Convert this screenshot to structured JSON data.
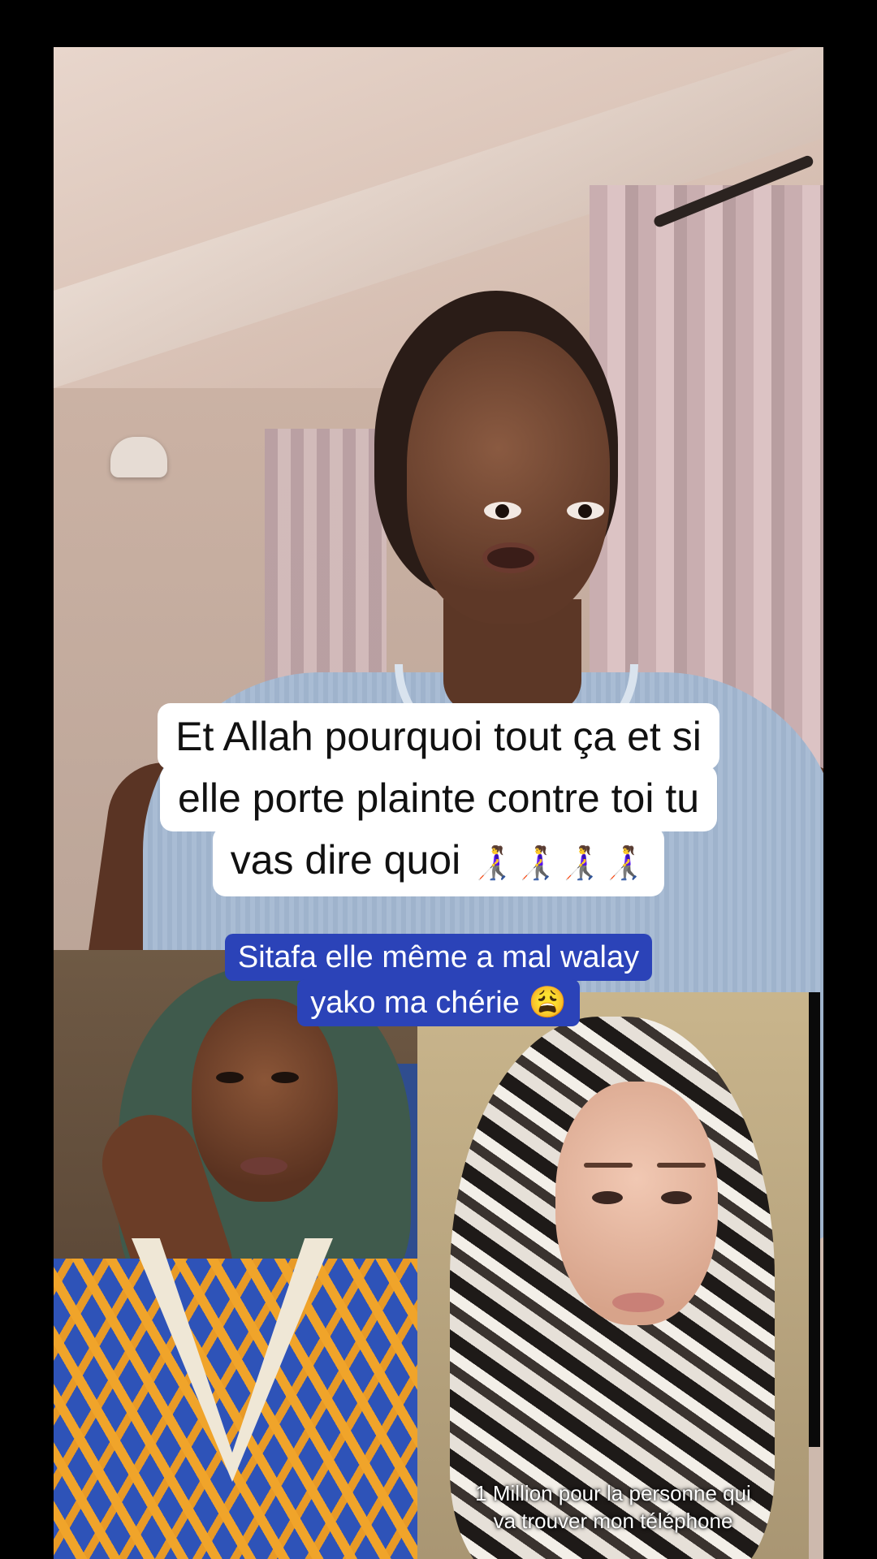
{
  "video": {
    "caption_main_lines": [
      "Et Allah pourquoi tout ça et si",
      "elle porte plainte contre toi tu",
      "vas dire quoi"
    ],
    "caption_main_emoji": "👩‍🦯👩‍🦯👩‍🦯👩‍🦯",
    "caption_blue_lines": [
      "Sitafa elle même a mal walay",
      "yako ma chérie 😩"
    ],
    "panel_right_caption_lines": [
      "1 Million pour la personne qui",
      "va trouver mon téléphone"
    ]
  },
  "colors": {
    "background": "#000000",
    "caption_main_bg": "#ffffff",
    "caption_blue_bg": "#2b43b8"
  }
}
